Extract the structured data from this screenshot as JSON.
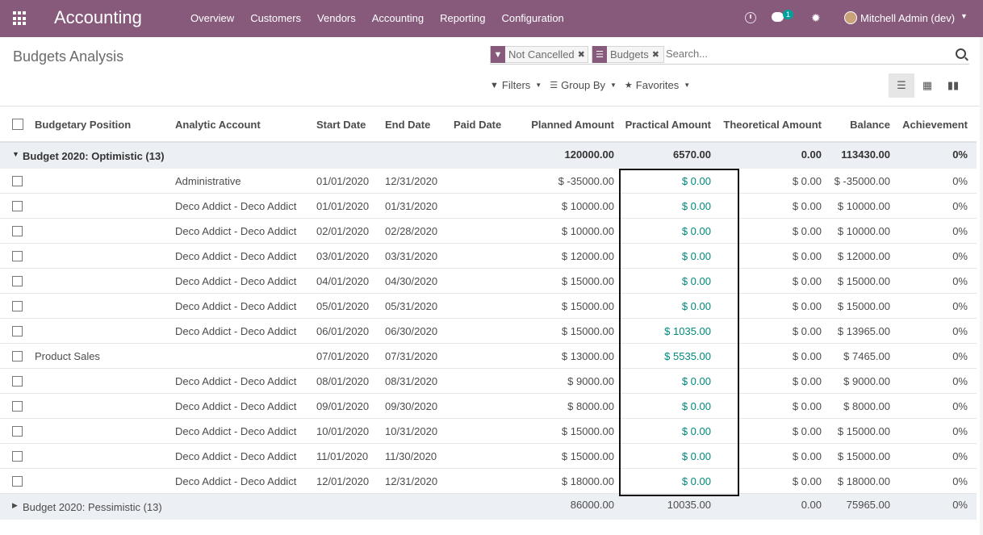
{
  "navbar": {
    "app_name": "Accounting",
    "menu": [
      "Overview",
      "Customers",
      "Vendors",
      "Accounting",
      "Reporting",
      "Configuration"
    ],
    "chat_count": "1",
    "user": "Mitchell Admin (dev)",
    "brand_color": "#875a7b"
  },
  "page": {
    "title": "Budgets Analysis"
  },
  "search": {
    "facets": [
      {
        "icon": "filter-icon",
        "label": "Not Cancelled"
      },
      {
        "icon": "group-by-icon",
        "label": "Budgets"
      }
    ],
    "placeholder": "Search..."
  },
  "controls": {
    "filters": "Filters",
    "group_by": "Group By",
    "favorites": "Favorites",
    "views": [
      "list-view-icon",
      "pivot-view-icon",
      "graph-view-icon"
    ],
    "active_view": "list-view-icon"
  },
  "table": {
    "columns": [
      "Budgetary Position",
      "Analytic Account",
      "Start Date",
      "End Date",
      "Paid Date",
      "Planned Amount",
      "Practical Amount",
      "Theoretical Amount",
      "Balance",
      "Achievement"
    ],
    "groups": [
      {
        "label": "Budget 2020: Optimistic (13)",
        "expanded": true,
        "planned": "120000.00",
        "practical": "6570.00",
        "theoretical": "0.00",
        "balance": "113430.00",
        "achievement": "0%",
        "rows": [
          {
            "position": "",
            "account": "Administrative",
            "start": "01/01/2020",
            "end": "12/31/2020",
            "paid": "",
            "planned": "$ -35000.00",
            "practical": "$ 0.00",
            "theoretical": "$ 0.00",
            "balance": "$ -35000.00",
            "achievement": "0%"
          },
          {
            "position": "",
            "account": "Deco Addict - Deco Addict",
            "start": "01/01/2020",
            "end": "01/31/2020",
            "paid": "",
            "planned": "$ 10000.00",
            "practical": "$ 0.00",
            "theoretical": "$ 0.00",
            "balance": "$ 10000.00",
            "achievement": "0%"
          },
          {
            "position": "",
            "account": "Deco Addict - Deco Addict",
            "start": "02/01/2020",
            "end": "02/28/2020",
            "paid": "",
            "planned": "$ 10000.00",
            "practical": "$ 0.00",
            "theoretical": "$ 0.00",
            "balance": "$ 10000.00",
            "achievement": "0%"
          },
          {
            "position": "",
            "account": "Deco Addict - Deco Addict",
            "start": "03/01/2020",
            "end": "03/31/2020",
            "paid": "",
            "planned": "$ 12000.00",
            "practical": "$ 0.00",
            "theoretical": "$ 0.00",
            "balance": "$ 12000.00",
            "achievement": "0%"
          },
          {
            "position": "",
            "account": "Deco Addict - Deco Addict",
            "start": "04/01/2020",
            "end": "04/30/2020",
            "paid": "",
            "planned": "$ 15000.00",
            "practical": "$ 0.00",
            "theoretical": "$ 0.00",
            "balance": "$ 15000.00",
            "achievement": "0%"
          },
          {
            "position": "",
            "account": "Deco Addict - Deco Addict",
            "start": "05/01/2020",
            "end": "05/31/2020",
            "paid": "",
            "planned": "$ 15000.00",
            "practical": "$ 0.00",
            "theoretical": "$ 0.00",
            "balance": "$ 15000.00",
            "achievement": "0%"
          },
          {
            "position": "",
            "account": "Deco Addict - Deco Addict",
            "start": "06/01/2020",
            "end": "06/30/2020",
            "paid": "",
            "planned": "$ 15000.00",
            "practical": "$ 1035.00",
            "theoretical": "$ 0.00",
            "balance": "$ 13965.00",
            "achievement": "0%"
          },
          {
            "position": "Product Sales",
            "account": "",
            "start": "07/01/2020",
            "end": "07/31/2020",
            "paid": "",
            "planned": "$ 13000.00",
            "practical": "$ 5535.00",
            "theoretical": "$ 0.00",
            "balance": "$ 7465.00",
            "achievement": "0%"
          },
          {
            "position": "",
            "account": "Deco Addict - Deco Addict",
            "start": "08/01/2020",
            "end": "08/31/2020",
            "paid": "",
            "planned": "$ 9000.00",
            "practical": "$ 0.00",
            "theoretical": "$ 0.00",
            "balance": "$ 9000.00",
            "achievement": "0%"
          },
          {
            "position": "",
            "account": "Deco Addict - Deco Addict",
            "start": "09/01/2020",
            "end": "09/30/2020",
            "paid": "",
            "planned": "$ 8000.00",
            "practical": "$ 0.00",
            "theoretical": "$ 0.00",
            "balance": "$ 8000.00",
            "achievement": "0%"
          },
          {
            "position": "",
            "account": "Deco Addict - Deco Addict",
            "start": "10/01/2020",
            "end": "10/31/2020",
            "paid": "",
            "planned": "$ 15000.00",
            "practical": "$ 0.00",
            "theoretical": "$ 0.00",
            "balance": "$ 15000.00",
            "achievement": "0%"
          },
          {
            "position": "",
            "account": "Deco Addict - Deco Addict",
            "start": "11/01/2020",
            "end": "11/30/2020",
            "paid": "",
            "planned": "$ 15000.00",
            "practical": "$ 0.00",
            "theoretical": "$ 0.00",
            "balance": "$ 15000.00",
            "achievement": "0%"
          },
          {
            "position": "",
            "account": "Deco Addict - Deco Addict",
            "start": "12/01/2020",
            "end": "12/31/2020",
            "paid": "",
            "planned": "$ 18000.00",
            "practical": "$ 0.00",
            "theoretical": "$ 0.00",
            "balance": "$ 18000.00",
            "achievement": "0%"
          }
        ]
      },
      {
        "label": "Budget 2020: Pessimistic (13)",
        "expanded": false,
        "planned": "86000.00",
        "practical": "10035.00",
        "theoretical": "0.00",
        "balance": "75965.00",
        "achievement": "0%",
        "rows": []
      }
    ]
  }
}
